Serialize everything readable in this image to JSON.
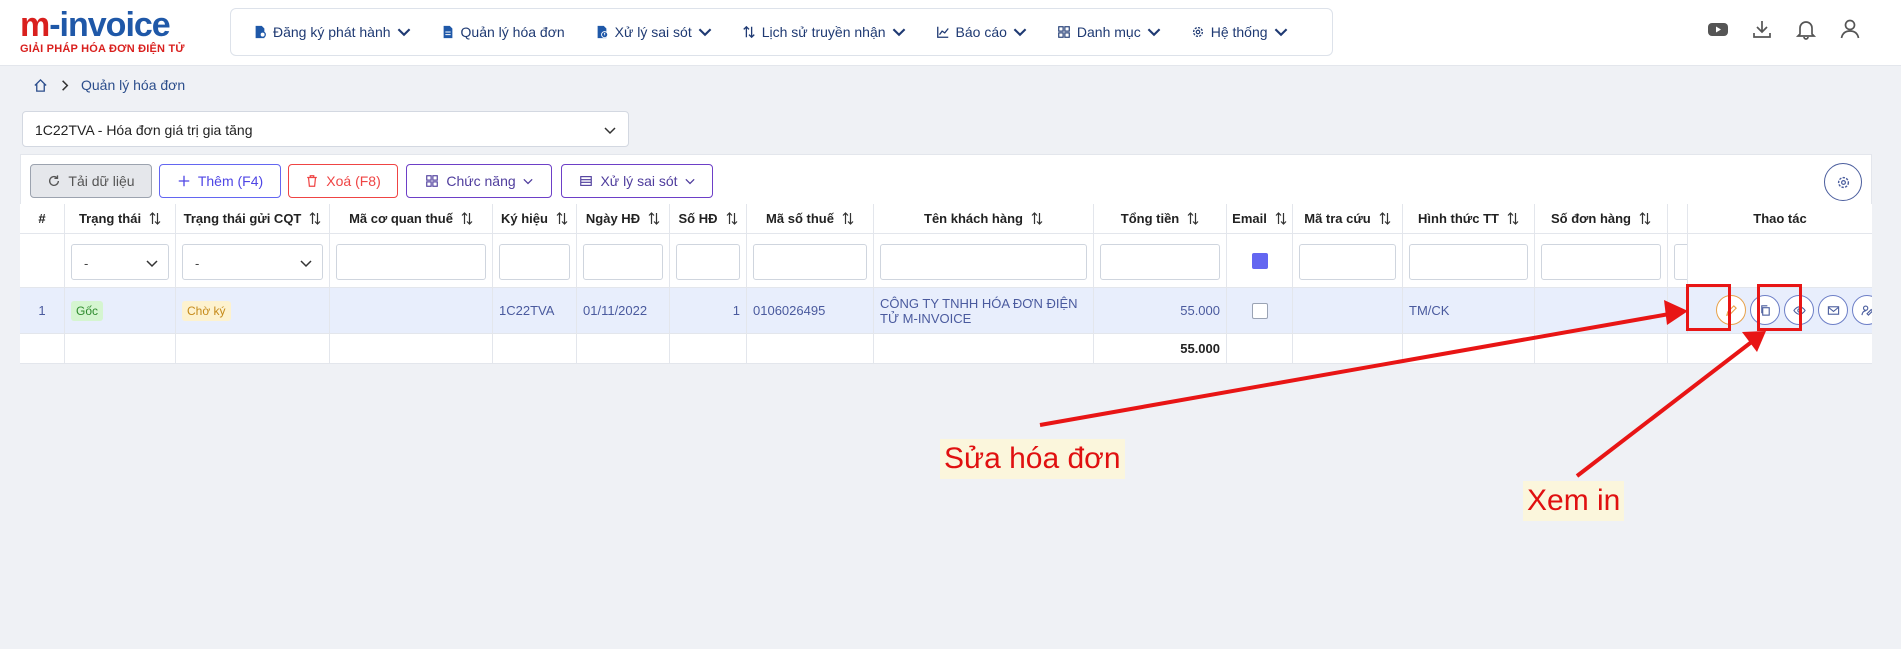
{
  "logo": {
    "main_m": "m",
    "main_rest": "-invoice",
    "tagline": "GIẢI PHÁP HÓA ĐƠN ĐIỆN TỬ"
  },
  "nav": [
    {
      "label": "Đăng ký phát hành",
      "icon": "file-settings-icon",
      "dropdown": true
    },
    {
      "label": "Quản lý hóa đơn",
      "icon": "file-icon",
      "dropdown": false
    },
    {
      "label": "Xử lý sai sót",
      "icon": "file-alert-icon",
      "dropdown": true
    },
    {
      "label": "Lịch sử truyền nhận",
      "icon": "sort-arrows-icon",
      "dropdown": true
    },
    {
      "label": "Báo cáo",
      "icon": "chart-icon",
      "dropdown": true
    },
    {
      "label": "Danh mục",
      "icon": "grid-icon",
      "dropdown": true
    },
    {
      "label": "Hệ thống",
      "icon": "gear-icon",
      "dropdown": true
    }
  ],
  "top_icons": [
    "youtube-icon",
    "download-icon",
    "bell-icon",
    "user-icon"
  ],
  "breadcrumb": {
    "current": "Quản lý hóa đơn"
  },
  "series_select": {
    "value": "1C22TVA - Hóa đơn giá trị gia tăng"
  },
  "toolbar": {
    "reload": "Tải dữ liệu",
    "add": "Thêm (F4)",
    "delete": "Xoá (F8)",
    "functions": "Chức năng",
    "fix_errors": "Xử lý sai sót"
  },
  "table": {
    "headers": {
      "index": "#",
      "status": "Trạng thái",
      "cqt_status": "Trạng thái gửi CQT",
      "tax_code_agency": "Mã cơ quan thuế",
      "symbol": "Ký hiệu",
      "date": "Ngày HĐ",
      "number": "Số HĐ",
      "tax_id": "Mã số thuế",
      "customer": "Tên khách hàng",
      "total": "Tổng tiền",
      "email": "Email",
      "lookup": "Mã tra cứu",
      "payment": "Hình thức TT",
      "order_no": "Số đơn hàng",
      "actions": "Thao tác"
    },
    "filters": {
      "status": "-",
      "cqt_status": "-"
    },
    "rows": [
      {
        "index": "1",
        "status": "Gốc",
        "cqt_status": "Chờ ký",
        "tax_code_agency": "",
        "symbol": "1C22TVA",
        "date": "01/11/2022",
        "number": "1",
        "tax_id": "0106026495",
        "customer_line1": "CÔNG TY TNHH HÓA ĐƠN ĐIỆN",
        "customer_line2": "TỬ M-INVOICE",
        "total": "55.000",
        "lookup": "",
        "payment": "TM/CK",
        "order_no": ""
      }
    ],
    "footer_total": "55.000",
    "action_icons": [
      "edit-icon",
      "copy-icon",
      "eye-icon",
      "mail-icon",
      "sign-icon"
    ]
  },
  "annotations": {
    "edit_callout": "Sửa hóa đơn",
    "view_callout": "Xem in "
  },
  "colors": {
    "accent": "#6366f1",
    "danger": "#ef4444",
    "annotation": "#e81515",
    "row_highlight": "#e8eefc"
  }
}
